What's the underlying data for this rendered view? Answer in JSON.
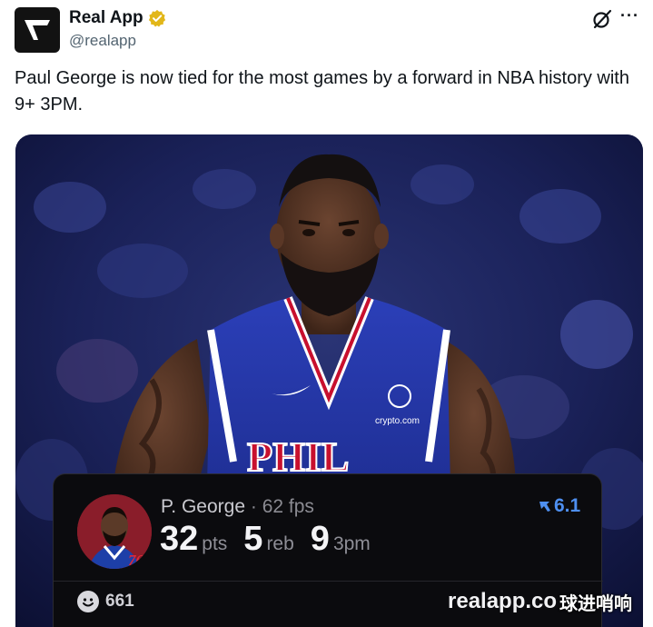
{
  "account": {
    "display_name": "Real App",
    "handle": "@realapp",
    "verified": true,
    "avatar_icon": "real-app-logo-icon"
  },
  "header_actions": {
    "grok_icon": "grok-icon",
    "more_icon": "more-options-icon",
    "more_glyph": "···"
  },
  "tweet": {
    "text": "Paul George is now tied for the most games by a forward in NBA history with 9+ 3PM."
  },
  "media": {
    "jersey_text": "PHIL",
    "sponsor_text": "crypto.com",
    "player_card": {
      "name": "P. George",
      "separator": "·",
      "fps": "62 fps",
      "rating": "6.1",
      "stats": [
        {
          "value": "32",
          "unit": "pts"
        },
        {
          "value": "5",
          "unit": "reb"
        },
        {
          "value": "9",
          "unit": "3pm"
        }
      ],
      "team_badge": "76",
      "reactions": "661",
      "site": "realapp.co"
    },
    "watermark": "球进哨响"
  },
  "colors": {
    "accent_blue": "#4e8ff0",
    "verified_gold": "#e2b719",
    "card_bg": "#0b0b0e"
  }
}
